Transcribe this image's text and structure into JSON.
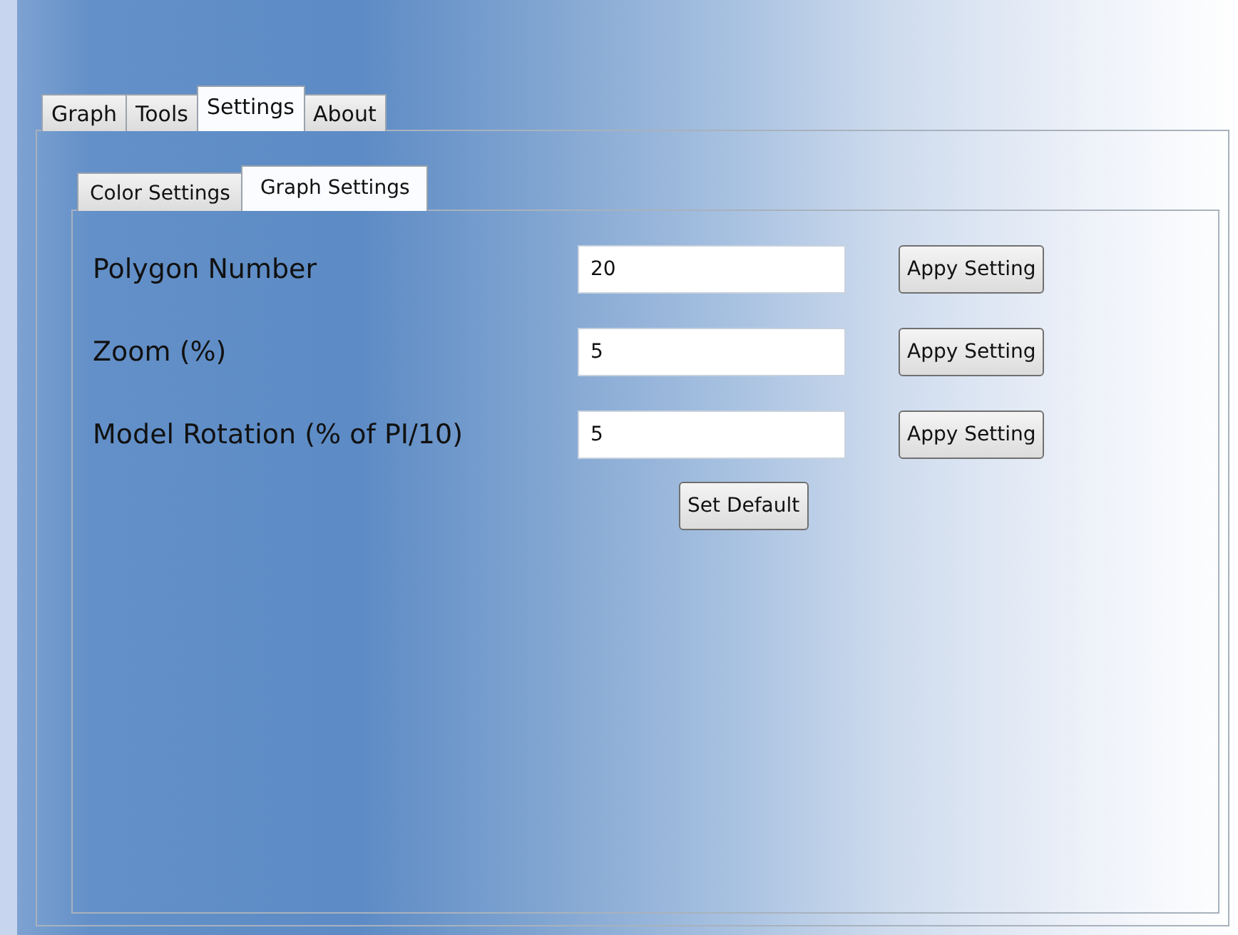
{
  "tabs": [
    {
      "label": "Graph",
      "selected": false
    },
    {
      "label": "Tools",
      "selected": false
    },
    {
      "label": "Settings",
      "selected": true
    },
    {
      "label": "About",
      "selected": false
    }
  ],
  "subtabs": [
    {
      "label": "Color Settings",
      "selected": false
    },
    {
      "label": "Graph Settings",
      "selected": true
    }
  ],
  "settings": [
    {
      "label": "Polygon Number",
      "value": "20",
      "button": "Appy Setting"
    },
    {
      "label": "Zoom (%)",
      "value": "5",
      "button": "Appy Setting"
    },
    {
      "label": "Model Rotation (% of PI/10)",
      "value": "5",
      "button": "Appy Setting"
    }
  ],
  "default_button": "Set Default"
}
